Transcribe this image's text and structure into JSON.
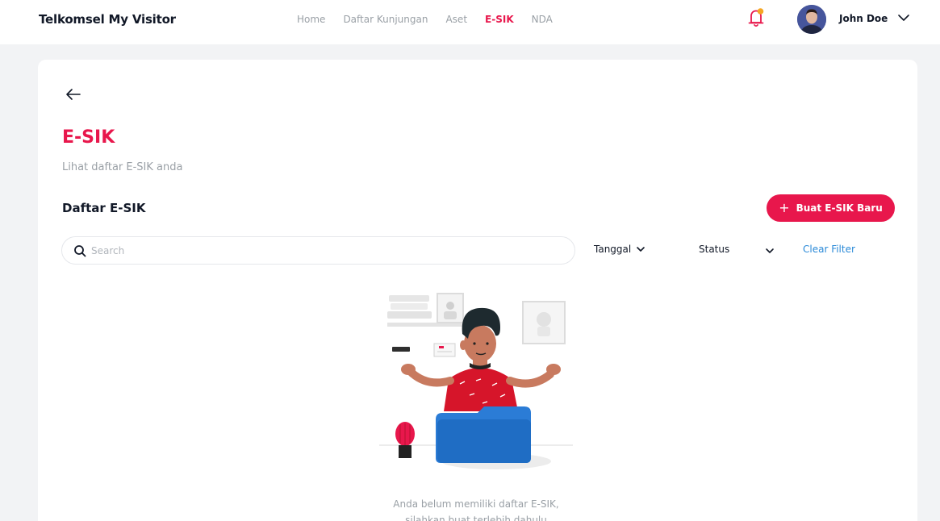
{
  "app": {
    "title": "Telkomsel My Visitor"
  },
  "nav": {
    "items": [
      {
        "label": "Home",
        "active": false
      },
      {
        "label": "Daftar Kunjungan",
        "active": false
      },
      {
        "label": "Aset",
        "active": false
      },
      {
        "label": "E-SIK",
        "active": true
      },
      {
        "label": "NDA",
        "active": false
      }
    ]
  },
  "user": {
    "name": "John Doe",
    "notification_icon": "bell-icon",
    "has_unread": true
  },
  "page": {
    "title": "E-SIK",
    "subtitle": "Lihat daftar E-SIK anda",
    "section_title": "Daftar E-SIK",
    "new_button_label": "Buat E-SIK Baru"
  },
  "search": {
    "placeholder": "Search",
    "value": ""
  },
  "filters": {
    "date_label": "Tanggal",
    "status_label": "Status",
    "clear_label": "Clear Filter"
  },
  "empty_state": {
    "line1": "Anda belum memiliki daftar E-SIK,",
    "line2": "silahkan buat terlebih dahulu"
  },
  "colors": {
    "accent": "#e8174c",
    "link": "#2b8ad8",
    "muted": "#9aa0a6",
    "background": "#f2f3f5"
  }
}
